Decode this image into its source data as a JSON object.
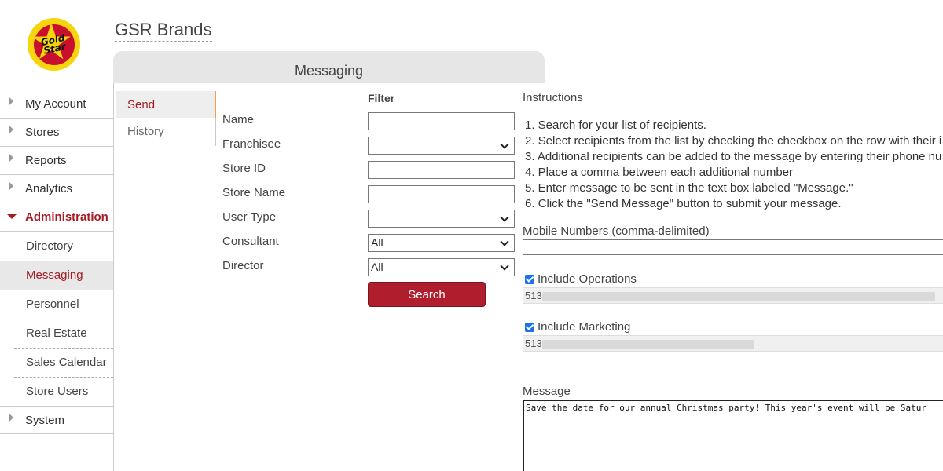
{
  "brand": {
    "logo_text_line1": "Gold",
    "logo_text_line2": "Star",
    "title": "GSR Brands"
  },
  "sidebar": {
    "items": [
      {
        "label": "My Account"
      },
      {
        "label": "Stores"
      },
      {
        "label": "Reports"
      },
      {
        "label": "Analytics"
      },
      {
        "label": "Administration"
      },
      {
        "label": "System"
      }
    ],
    "admin_sub": [
      {
        "label": "Directory"
      },
      {
        "label": "Messaging"
      },
      {
        "label": "Personnel"
      },
      {
        "label": "Real Estate"
      },
      {
        "label": "Sales Calendar"
      },
      {
        "label": "Store Users"
      }
    ]
  },
  "page": {
    "tab_title": "Messaging",
    "subtabs": [
      {
        "label": "Send"
      },
      {
        "label": "History"
      }
    ]
  },
  "filter": {
    "heading": "Filter",
    "fields": {
      "name_label": "Name",
      "franchisee_label": "Franchisee",
      "store_id_label": "Store ID",
      "store_name_label": "Store Name",
      "user_type_label": "User Type",
      "consultant_label": "Consultant",
      "consultant_value": "All",
      "director_label": "Director",
      "director_value": "All"
    },
    "search_button": "Search"
  },
  "instructions": {
    "title": "Instructions",
    "steps": [
      "1. Search for your list of recipients.",
      "2. Select recipients from the list by checking the checkbox on the row with their i",
      "3. Additional recipients can be added to the message by entering their phone nu",
      "4. Place a comma between each additional number",
      "5. Enter message to be sent in the text box labeled \"Message.\"",
      "6. Click the \"Send Message\" button to submit your message."
    ]
  },
  "mobile": {
    "label": "Mobile Numbers (comma-delimited)",
    "value": ""
  },
  "operations": {
    "label": "Include Operations",
    "checked": true,
    "numbers_prefix": "513"
  },
  "marketing": {
    "label": "Include Marketing",
    "checked": true,
    "numbers_prefix": "513"
  },
  "message": {
    "label": "Message",
    "value": "Save the date for our annual Christmas party! This year's event will be Satur"
  },
  "colors": {
    "accent": "#a51c24",
    "button": "#b01e2d",
    "logo_yellow": "#f6d40e",
    "logo_red": "#c8102e"
  }
}
